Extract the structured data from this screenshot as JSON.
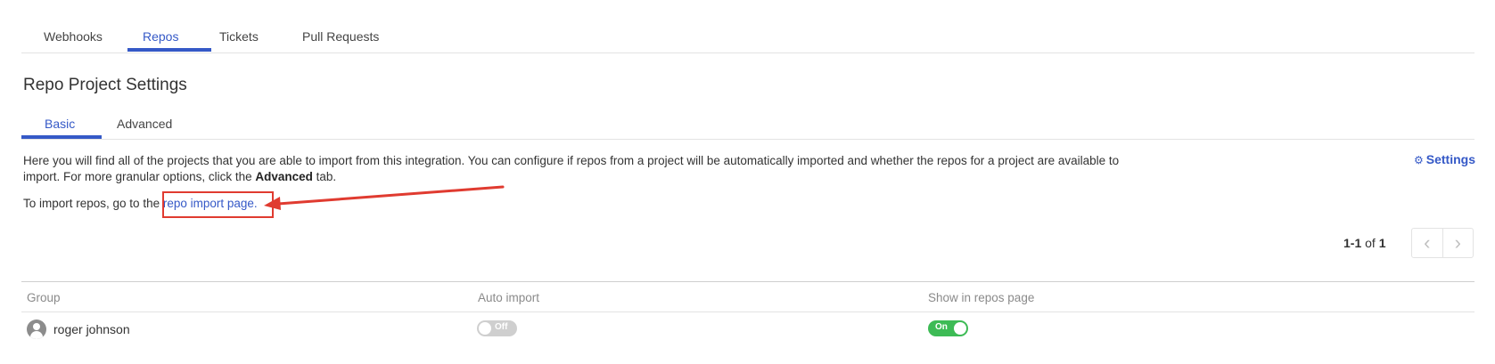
{
  "top_tabs": [
    "Webhooks",
    "Repos",
    "Tickets",
    "Pull Requests"
  ],
  "page_title": "Repo Project Settings",
  "sub_tabs": [
    "Basic",
    "Advanced"
  ],
  "description": {
    "text": "Here you will find all of the projects that you are able to import from this integration. You can configure if repos from a project will be automatically imported and whether the repos for a project are available to import. For more granular options, click the ",
    "bold": "Advanced",
    "suffix": " tab."
  },
  "settings_link": "Settings",
  "import_line": {
    "prefix": "To import repos, go to the ",
    "link": "repo import page",
    "suffix": "."
  },
  "pagination": {
    "range": "1-1",
    "of": "of",
    "total": "1"
  },
  "table": {
    "headers": [
      "Group",
      "Auto import",
      "Show in repos page"
    ],
    "rows": [
      {
        "group": "roger johnson",
        "auto_import": "Off",
        "show_in_repos": "On"
      }
    ]
  },
  "colors": {
    "accent": "#3559c7",
    "annotation": "#e03b30",
    "toggle_on": "#3dbb55",
    "toggle_off": "#cfcfcf"
  },
  "icons": [
    "gear-icon",
    "chevron-left-icon",
    "chevron-right-icon",
    "user-avatar-icon"
  ]
}
